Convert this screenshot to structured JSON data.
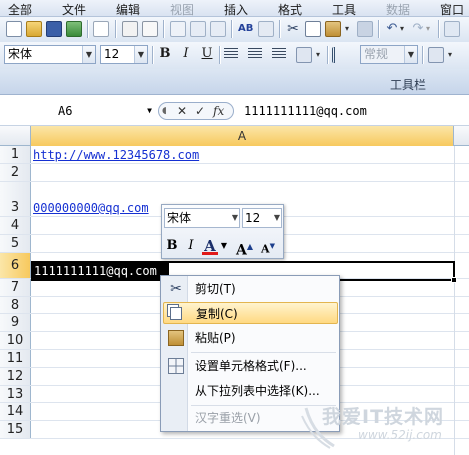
{
  "menubar": [
    "全部",
    "文件",
    "编辑",
    "视图",
    "插入",
    "格式",
    "工具",
    "数据",
    "窗口"
  ],
  "toolbar": {
    "font_name": "宋体",
    "font_size": "12",
    "style_combo": "常规",
    "label": "工具栏"
  },
  "formula_bar": {
    "name_box": "A6",
    "cancel": "✕",
    "enter": "✓",
    "fx": "fx",
    "content": "1111111111@qq.com"
  },
  "column_header": "A",
  "rows": [
    {
      "num": "1",
      "text": "http://www.12345678.com",
      "type": "link"
    },
    {
      "num": "2",
      "text": ""
    },
    {
      "num": "3",
      "text": "000000000@qq.com",
      "type": "link"
    },
    {
      "num": "4",
      "text": ""
    },
    {
      "num": "5",
      "text": ""
    },
    {
      "num": "6",
      "text": "1111111111@qq.com",
      "selected": true
    },
    {
      "num": "7",
      "text": ""
    },
    {
      "num": "8",
      "text": ""
    },
    {
      "num": "9",
      "text": ""
    },
    {
      "num": "10",
      "text": ""
    },
    {
      "num": "11",
      "text": ""
    },
    {
      "num": "12",
      "text": ""
    },
    {
      "num": "13",
      "text": ""
    },
    {
      "num": "14",
      "text": ""
    },
    {
      "num": "15",
      "text": ""
    }
  ],
  "mini_toolbar": {
    "font_name": "宋体",
    "font_size": "12",
    "bold": "B",
    "italic": "I",
    "font_color": "A",
    "grow": "A",
    "shrink": "A"
  },
  "context_menu": {
    "items": [
      {
        "label": "剪切(T)",
        "icon": "scissors-icon"
      },
      {
        "label": "复制(C)",
        "icon": "copy-icon",
        "highlighted": true
      },
      {
        "label": "粘贴(P)",
        "icon": "paste-icon"
      },
      {
        "label": "设置单元格格式(F)...",
        "icon": "format-cells-icon"
      },
      {
        "label": "从下拉列表中选择(K)...",
        "icon": ""
      },
      {
        "label": "汉字重选(V)",
        "icon": "",
        "disabled": true
      }
    ]
  },
  "watermark": {
    "text": "我爱IT技术网",
    "url": "www.52ij.com"
  },
  "colors": {
    "accent": "#f7c95e",
    "menu_highlight": "#ffd982",
    "link": "#1530d2"
  }
}
